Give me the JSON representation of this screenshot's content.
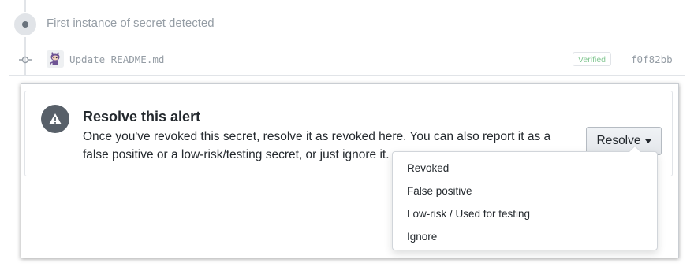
{
  "timeline": {
    "event_text": "First instance of secret detected",
    "commit": {
      "message": "Update README.md",
      "verified_label": "Verified",
      "sha": "f0f82bb"
    }
  },
  "alert": {
    "title": "Resolve this alert",
    "description": "Once you've revoked this secret, resolve it as revoked here. You can also report it as a false positive or a low-risk/testing secret, or just ignore it.",
    "resolve_button_label": "Resolve"
  },
  "resolve_menu": {
    "items": [
      {
        "label": "Revoked"
      },
      {
        "label": "False positive"
      },
      {
        "label": "Low-risk / Used for testing"
      },
      {
        "label": "Ignore"
      }
    ]
  },
  "colors": {
    "muted_text": "#959da5",
    "verified_green": "#85c894",
    "alert_icon_bg": "#586069"
  },
  "icons": {
    "event": "dot-icon",
    "commit": "git-commit-icon",
    "avatar": "octocat-avatar-icon",
    "alert": "alert-triangle-icon",
    "dropdown": "caret-down-icon"
  }
}
